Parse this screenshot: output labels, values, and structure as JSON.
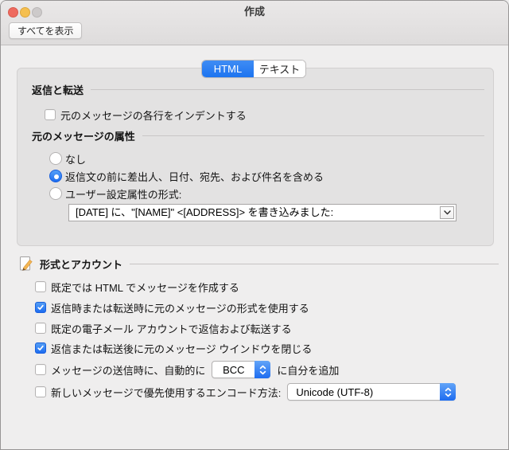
{
  "window": {
    "title": "作成",
    "toolbar": {
      "show_all_label": "すべてを表示"
    }
  },
  "tabs": {
    "html_label": "HTML",
    "text_label": "テキスト",
    "selected": "HTML"
  },
  "reply_forward": {
    "title": "返信と転送",
    "indent_checkbox": {
      "label": "元のメッセージの各行をインデントする",
      "checked": false
    }
  },
  "original_attrs": {
    "title": "元のメッセージの属性",
    "radio_none": {
      "label": "なし",
      "selected": false
    },
    "radio_include": {
      "label": "返信文の前に差出人、日付、宛先、および件名を含める",
      "selected": true
    },
    "radio_custom": {
      "label": "ユーザー設定属性の形式:",
      "selected": false
    },
    "custom_format_value": "[DATE] に、\"[NAME]\" <[ADDRESS]> を書き込みました:"
  },
  "format_accounts": {
    "title": "形式とアカウント",
    "cb_html_default": {
      "label": "既定では HTML でメッセージを作成する",
      "checked": false
    },
    "cb_use_original_format": {
      "label": "返信時または転送時に元のメッセージの形式を使用する",
      "checked": true
    },
    "cb_default_account": {
      "label": "既定の電子メール アカウントで返信および転送する",
      "checked": false
    },
    "cb_close_window": {
      "label": "返信または転送後に元のメッセージ ウインドウを閉じる",
      "checked": true
    },
    "cb_auto_bcc": {
      "label_before": "メッセージの送信時に、自動的に",
      "popup_value": "BCC",
      "label_after": "に自分を追加",
      "checked": false
    },
    "cb_encoding": {
      "label": "新しいメッセージで優先使用するエンコード方法:",
      "popup_value": "Unicode (UTF-8)",
      "checked": false
    }
  },
  "colors": {
    "accent_blue": "#1d6cf0",
    "segment_selected": "#2e80f2",
    "panel_bg": "#e3e2e2",
    "window_bg": "#efeeee",
    "titlebar_bg": "#e5e3e3",
    "traffic_red": "#ee6a5f",
    "traffic_yellow": "#f5bf4f",
    "traffic_gray": "#cdcaca"
  }
}
